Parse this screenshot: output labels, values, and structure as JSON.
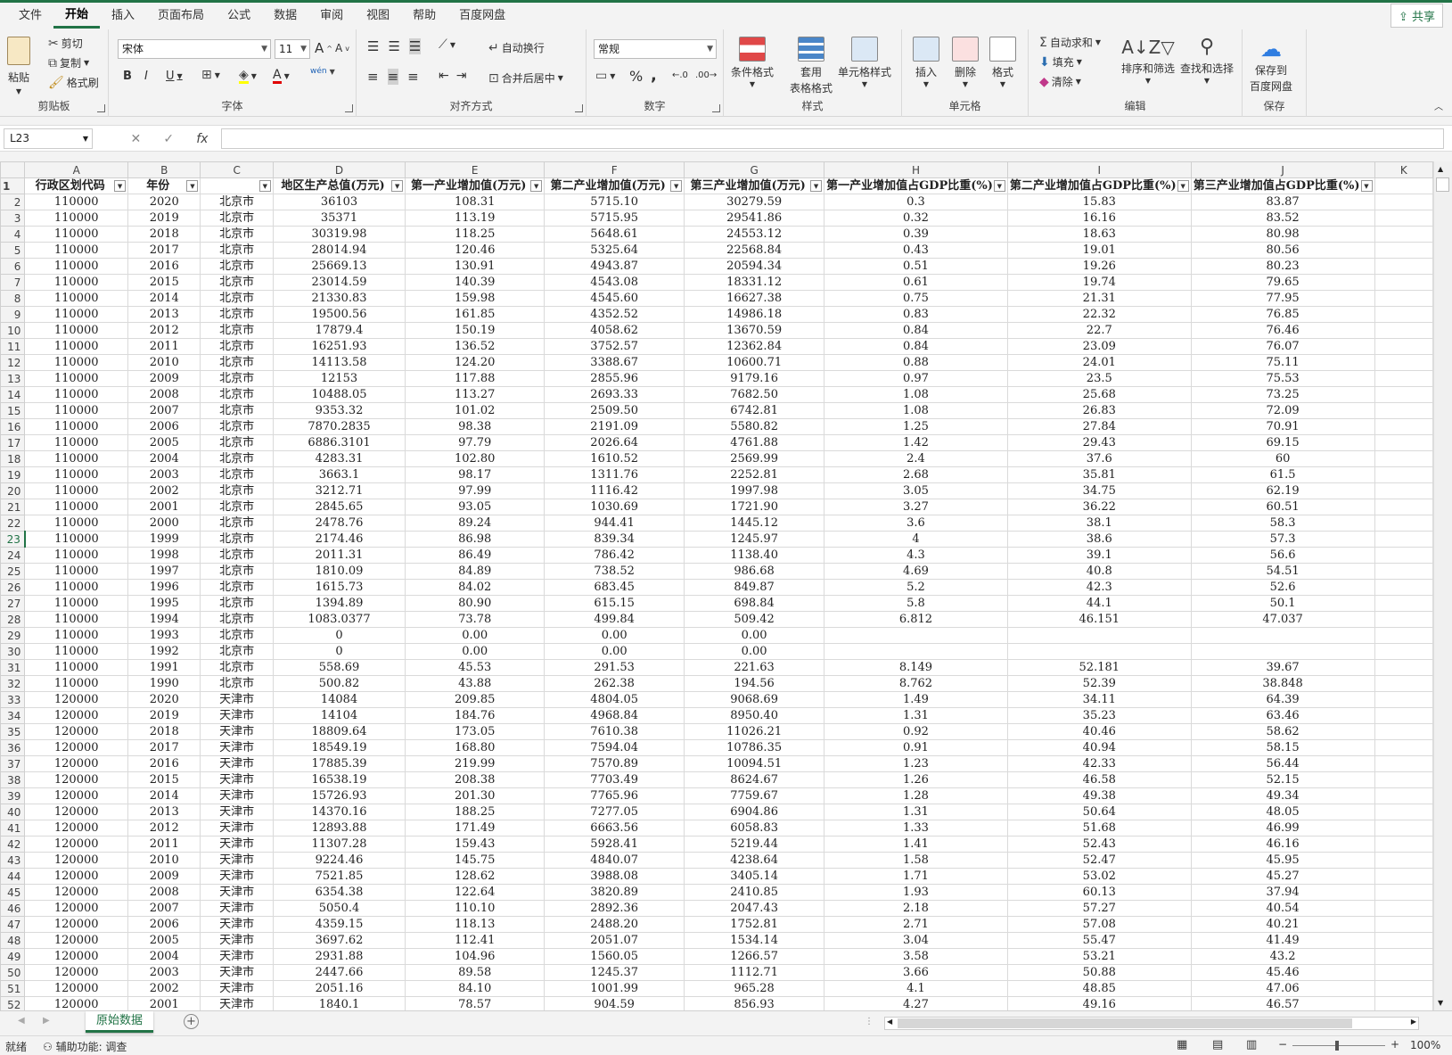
{
  "menu": {
    "items": [
      "文件",
      "开始",
      "插入",
      "页面布局",
      "公式",
      "数据",
      "审阅",
      "视图",
      "帮助",
      "百度网盘"
    ],
    "active": "开始",
    "share": "共享"
  },
  "ribbon": {
    "clipboard": {
      "label": "剪贴板",
      "paste": "粘贴",
      "cut": "剪切",
      "copy": "复制",
      "format_painter": "格式刷"
    },
    "font": {
      "label": "字体",
      "name": "宋体",
      "size": "11",
      "bold": "B",
      "italic": "I",
      "underline": "U",
      "font_color": "A",
      "grow": "A",
      "shrink": "A",
      "wen": "wén"
    },
    "alignment": {
      "label": "对齐方式",
      "wrap": "自动换行",
      "merge": "合并后居中"
    },
    "number": {
      "label": "数字",
      "format": "常规",
      "percent": "%",
      "comma": ","
    },
    "styles": {
      "label": "样式",
      "cond_format": "条件格式",
      "table_format_1": "套用",
      "table_format_2": "表格格式",
      "cell_styles": "单元格样式"
    },
    "cells": {
      "label": "单元格",
      "insert": "插入",
      "delete": "删除",
      "format": "格式"
    },
    "editing": {
      "label": "编辑",
      "autosum": "自动求和",
      "fill": "填充",
      "clear": "清除",
      "sort_filter": "排序和筛选",
      "find_select": "查找和选择"
    },
    "save": {
      "label": "保存",
      "save_1": "保存到",
      "save_2": "百度网盘"
    }
  },
  "formula_bar": {
    "name_box": "L23",
    "fx": "fx",
    "content": ""
  },
  "columns": [
    "A",
    "B",
    "C",
    "D",
    "E",
    "F",
    "G",
    "H",
    "I",
    "J",
    "K"
  ],
  "header_row": [
    "行政区划代码",
    "年份",
    "",
    "地区生产总值(万元)",
    "第一产业增加值(万元)",
    "第二产业增加值(万元)",
    "第三产业增加值(万元)",
    "第一产业增加值占GDP比重(%)",
    "第二产业增加值占GDP比重(%)",
    "第三产业增加值占GDP比重(%)",
    ""
  ],
  "rows": [
    [
      "110000",
      "2020",
      "北京市",
      "36103",
      "108.31",
      "5715.10",
      "30279.59",
      "0.3",
      "15.83",
      "83.87"
    ],
    [
      "110000",
      "2019",
      "北京市",
      "35371",
      "113.19",
      "5715.95",
      "29541.86",
      "0.32",
      "16.16",
      "83.52"
    ],
    [
      "110000",
      "2018",
      "北京市",
      "30319.98",
      "118.25",
      "5648.61",
      "24553.12",
      "0.39",
      "18.63",
      "80.98"
    ],
    [
      "110000",
      "2017",
      "北京市",
      "28014.94",
      "120.46",
      "5325.64",
      "22568.84",
      "0.43",
      "19.01",
      "80.56"
    ],
    [
      "110000",
      "2016",
      "北京市",
      "25669.13",
      "130.91",
      "4943.87",
      "20594.34",
      "0.51",
      "19.26",
      "80.23"
    ],
    [
      "110000",
      "2015",
      "北京市",
      "23014.59",
      "140.39",
      "4543.08",
      "18331.12",
      "0.61",
      "19.74",
      "79.65"
    ],
    [
      "110000",
      "2014",
      "北京市",
      "21330.83",
      "159.98",
      "4545.60",
      "16627.38",
      "0.75",
      "21.31",
      "77.95"
    ],
    [
      "110000",
      "2013",
      "北京市",
      "19500.56",
      "161.85",
      "4352.52",
      "14986.18",
      "0.83",
      "22.32",
      "76.85"
    ],
    [
      "110000",
      "2012",
      "北京市",
      "17879.4",
      "150.19",
      "4058.62",
      "13670.59",
      "0.84",
      "22.7",
      "76.46"
    ],
    [
      "110000",
      "2011",
      "北京市",
      "16251.93",
      "136.52",
      "3752.57",
      "12362.84",
      "0.84",
      "23.09",
      "76.07"
    ],
    [
      "110000",
      "2010",
      "北京市",
      "14113.58",
      "124.20",
      "3388.67",
      "10600.71",
      "0.88",
      "24.01",
      "75.11"
    ],
    [
      "110000",
      "2009",
      "北京市",
      "12153",
      "117.88",
      "2855.96",
      "9179.16",
      "0.97",
      "23.5",
      "75.53"
    ],
    [
      "110000",
      "2008",
      "北京市",
      "10488.05",
      "113.27",
      "2693.33",
      "7682.50",
      "1.08",
      "25.68",
      "73.25"
    ],
    [
      "110000",
      "2007",
      "北京市",
      "9353.32",
      "101.02",
      "2509.50",
      "6742.81",
      "1.08",
      "26.83",
      "72.09"
    ],
    [
      "110000",
      "2006",
      "北京市",
      "7870.2835",
      "98.38",
      "2191.09",
      "5580.82",
      "1.25",
      "27.84",
      "70.91"
    ],
    [
      "110000",
      "2005",
      "北京市",
      "6886.3101",
      "97.79",
      "2026.64",
      "4761.88",
      "1.42",
      "29.43",
      "69.15"
    ],
    [
      "110000",
      "2004",
      "北京市",
      "4283.31",
      "102.80",
      "1610.52",
      "2569.99",
      "2.4",
      "37.6",
      "60"
    ],
    [
      "110000",
      "2003",
      "北京市",
      "3663.1",
      "98.17",
      "1311.76",
      "2252.81",
      "2.68",
      "35.81",
      "61.5"
    ],
    [
      "110000",
      "2002",
      "北京市",
      "3212.71",
      "97.99",
      "1116.42",
      "1997.98",
      "3.05",
      "34.75",
      "62.19"
    ],
    [
      "110000",
      "2001",
      "北京市",
      "2845.65",
      "93.05",
      "1030.69",
      "1721.90",
      "3.27",
      "36.22",
      "60.51"
    ],
    [
      "110000",
      "2000",
      "北京市",
      "2478.76",
      "89.24",
      "944.41",
      "1445.12",
      "3.6",
      "38.1",
      "58.3"
    ],
    [
      "110000",
      "1999",
      "北京市",
      "2174.46",
      "86.98",
      "839.34",
      "1245.97",
      "4",
      "38.6",
      "57.3"
    ],
    [
      "110000",
      "1998",
      "北京市",
      "2011.31",
      "86.49",
      "786.42",
      "1138.40",
      "4.3",
      "39.1",
      "56.6"
    ],
    [
      "110000",
      "1997",
      "北京市",
      "1810.09",
      "84.89",
      "738.52",
      "986.68",
      "4.69",
      "40.8",
      "54.51"
    ],
    [
      "110000",
      "1996",
      "北京市",
      "1615.73",
      "84.02",
      "683.45",
      "849.87",
      "5.2",
      "42.3",
      "52.6"
    ],
    [
      "110000",
      "1995",
      "北京市",
      "1394.89",
      "80.90",
      "615.15",
      "698.84",
      "5.8",
      "44.1",
      "50.1"
    ],
    [
      "110000",
      "1994",
      "北京市",
      "1083.0377",
      "73.78",
      "499.84",
      "509.42",
      "6.812",
      "46.151",
      "47.037"
    ],
    [
      "110000",
      "1993",
      "北京市",
      "0",
      "0.00",
      "0.00",
      "0.00",
      "",
      "",
      ""
    ],
    [
      "110000",
      "1992",
      "北京市",
      "0",
      "0.00",
      "0.00",
      "0.00",
      "",
      "",
      ""
    ],
    [
      "110000",
      "1991",
      "北京市",
      "558.69",
      "45.53",
      "291.53",
      "221.63",
      "8.149",
      "52.181",
      "39.67"
    ],
    [
      "110000",
      "1990",
      "北京市",
      "500.82",
      "43.88",
      "262.38",
      "194.56",
      "8.762",
      "52.39",
      "38.848"
    ],
    [
      "120000",
      "2020",
      "天津市",
      "14084",
      "209.85",
      "4804.05",
      "9068.69",
      "1.49",
      "34.11",
      "64.39"
    ],
    [
      "120000",
      "2019",
      "天津市",
      "14104",
      "184.76",
      "4968.84",
      "8950.40",
      "1.31",
      "35.23",
      "63.46"
    ],
    [
      "120000",
      "2018",
      "天津市",
      "18809.64",
      "173.05",
      "7610.38",
      "11026.21",
      "0.92",
      "40.46",
      "58.62"
    ],
    [
      "120000",
      "2017",
      "天津市",
      "18549.19",
      "168.80",
      "7594.04",
      "10786.35",
      "0.91",
      "40.94",
      "58.15"
    ],
    [
      "120000",
      "2016",
      "天津市",
      "17885.39",
      "219.99",
      "7570.89",
      "10094.51",
      "1.23",
      "42.33",
      "56.44"
    ],
    [
      "120000",
      "2015",
      "天津市",
      "16538.19",
      "208.38",
      "7703.49",
      "8624.67",
      "1.26",
      "46.58",
      "52.15"
    ],
    [
      "120000",
      "2014",
      "天津市",
      "15726.93",
      "201.30",
      "7765.96",
      "7759.67",
      "1.28",
      "49.38",
      "49.34"
    ],
    [
      "120000",
      "2013",
      "天津市",
      "14370.16",
      "188.25",
      "7277.05",
      "6904.86",
      "1.31",
      "50.64",
      "48.05"
    ],
    [
      "120000",
      "2012",
      "天津市",
      "12893.88",
      "171.49",
      "6663.56",
      "6058.83",
      "1.33",
      "51.68",
      "46.99"
    ],
    [
      "120000",
      "2011",
      "天津市",
      "11307.28",
      "159.43",
      "5928.41",
      "5219.44",
      "1.41",
      "52.43",
      "46.16"
    ],
    [
      "120000",
      "2010",
      "天津市",
      "9224.46",
      "145.75",
      "4840.07",
      "4238.64",
      "1.58",
      "52.47",
      "45.95"
    ],
    [
      "120000",
      "2009",
      "天津市",
      "7521.85",
      "128.62",
      "3988.08",
      "3405.14",
      "1.71",
      "53.02",
      "45.27"
    ],
    [
      "120000",
      "2008",
      "天津市",
      "6354.38",
      "122.64",
      "3820.89",
      "2410.85",
      "1.93",
      "60.13",
      "37.94"
    ],
    [
      "120000",
      "2007",
      "天津市",
      "5050.4",
      "110.10",
      "2892.36",
      "2047.43",
      "2.18",
      "57.27",
      "40.54"
    ],
    [
      "120000",
      "2006",
      "天津市",
      "4359.15",
      "118.13",
      "2488.20",
      "1752.81",
      "2.71",
      "57.08",
      "40.21"
    ],
    [
      "120000",
      "2005",
      "天津市",
      "3697.62",
      "112.41",
      "2051.07",
      "1534.14",
      "3.04",
      "55.47",
      "41.49"
    ],
    [
      "120000",
      "2004",
      "天津市",
      "2931.88",
      "104.96",
      "1560.05",
      "1266.57",
      "3.58",
      "53.21",
      "43.2"
    ],
    [
      "120000",
      "2003",
      "天津市",
      "2447.66",
      "89.58",
      "1245.37",
      "1112.71",
      "3.66",
      "50.88",
      "45.46"
    ],
    [
      "120000",
      "2002",
      "天津市",
      "2051.16",
      "84.10",
      "1001.99",
      "965.28",
      "4.1",
      "48.85",
      "47.06"
    ],
    [
      "120000",
      "2001",
      "天津市",
      "1840.1",
      "78.57",
      "904.59",
      "856.93",
      "4.27",
      "49.16",
      "46.57"
    ]
  ],
  "sheet": {
    "tab": "原始数据",
    "add": "+"
  },
  "status": {
    "ready": "就绪",
    "accessibility": "辅助功能: 调查",
    "zoom": "100%"
  },
  "colors": {
    "accent": "#217346",
    "grid": "#dadada",
    "header_bg": "#f3f3f3"
  }
}
